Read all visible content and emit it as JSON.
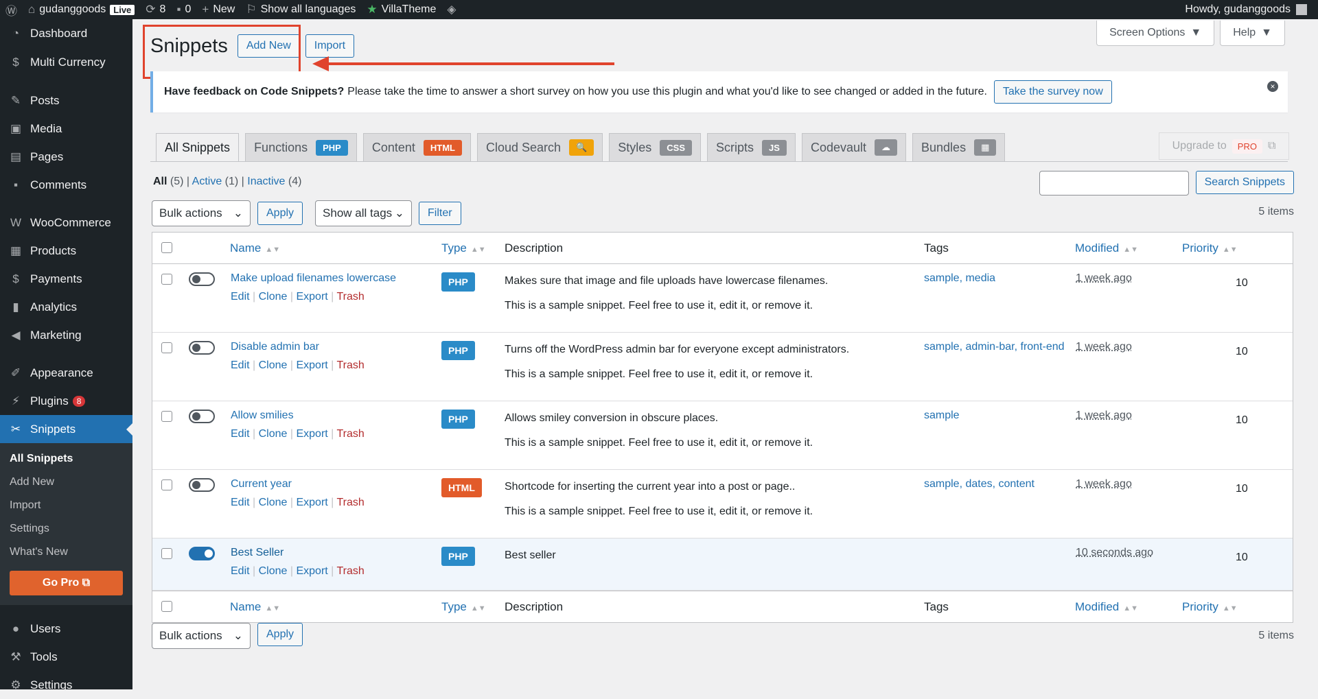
{
  "admin_bar": {
    "site_name": "gudanggoods",
    "live_label": "Live",
    "updates_count": "8",
    "comments_count": "0",
    "new_label": "New",
    "languages_label": "Show all languages",
    "villatheme_label": "VillaTheme",
    "howdy": "Howdy, gudanggoods"
  },
  "sidebar": {
    "items": [
      {
        "label": "Dashboard",
        "icon": "dashboard-icon"
      },
      {
        "label": "Multi Currency",
        "icon": "currency-icon"
      },
      {
        "label": "Posts",
        "icon": "pin-icon"
      },
      {
        "label": "Media",
        "icon": "media-icon"
      },
      {
        "label": "Pages",
        "icon": "page-icon"
      },
      {
        "label": "Comments",
        "icon": "comment-icon"
      },
      {
        "label": "WooCommerce",
        "icon": "woocommerce-icon"
      },
      {
        "label": "Products",
        "icon": "archive-icon"
      },
      {
        "label": "Payments",
        "icon": "payments-icon"
      },
      {
        "label": "Analytics",
        "icon": "bar-chart-icon"
      },
      {
        "label": "Marketing",
        "icon": "megaphone-icon"
      },
      {
        "label": "Appearance",
        "icon": "brush-icon"
      },
      {
        "label": "Plugins",
        "icon": "plug-icon",
        "badge": "8"
      },
      {
        "label": "Snippets",
        "icon": "scissors-icon"
      },
      {
        "label": "Users",
        "icon": "user-icon"
      },
      {
        "label": "Tools",
        "icon": "wrench-icon"
      },
      {
        "label": "Settings",
        "icon": "settings-icon"
      }
    ],
    "submenu": [
      "All Snippets",
      "Add New",
      "Import",
      "Settings",
      "What's New"
    ],
    "gopro_label": "Go Pro"
  },
  "header": {
    "title": "Snippets",
    "add_new_label": "Add New",
    "import_label": "Import",
    "screen_options_label": "Screen Options",
    "help_label": "Help"
  },
  "notice": {
    "strong": "Have feedback on Code Snippets?",
    "text": "Please take the time to answer a short survey on how you use this plugin and what you'd like to see changed or added in the future.",
    "button_label": "Take the survey now"
  },
  "tabs": [
    {
      "label": "All Snippets"
    },
    {
      "label": "Functions",
      "pill": "PHP"
    },
    {
      "label": "Content",
      "pill": "HTML"
    },
    {
      "label": "Cloud Search",
      "pill": "🔍"
    },
    {
      "label": "Styles",
      "pill": "CSS"
    },
    {
      "label": "Scripts",
      "pill": "JS"
    },
    {
      "label": "Codevault",
      "pill": "☁"
    },
    {
      "label": "Bundles",
      "pill": "▦"
    }
  ],
  "upgrade": {
    "label": "Upgrade to",
    "pro": "PRO"
  },
  "views": {
    "all": "All",
    "all_count": "(5)",
    "active": "Active",
    "active_count": "(1)",
    "inactive": "Inactive",
    "inactive_count": "(4)"
  },
  "search": {
    "button_label": "Search Snippets"
  },
  "tablenav": {
    "bulk_actions": "Bulk actions",
    "apply_label": "Apply",
    "tags_select": "Show all tags",
    "filter_label": "Filter",
    "items_count": "5 items"
  },
  "table": {
    "columns": {
      "name": "Name",
      "type": "Type",
      "description": "Description",
      "tags": "Tags",
      "modified": "Modified",
      "priority": "Priority"
    },
    "row_actions": {
      "edit": "Edit",
      "clone": "Clone",
      "export": "Export",
      "trash": "Trash"
    },
    "rows": [
      {
        "name": "Make upload filenames lowercase",
        "type": "PHP",
        "desc1": "Makes sure that image and file uploads have lowercase filenames.",
        "desc2": "This is a sample snippet. Feel free to use it, edit it, or remove it.",
        "tags": "sample, media",
        "modified": "1 week ago",
        "priority": "10",
        "active": false
      },
      {
        "name": "Disable admin bar",
        "type": "PHP",
        "desc1": "Turns off the WordPress admin bar for everyone except administrators.",
        "desc2": "This is a sample snippet. Feel free to use it, edit it, or remove it.",
        "tags": "sample, admin-bar, front-end",
        "modified": "1 week ago",
        "priority": "10",
        "active": false
      },
      {
        "name": "Allow smilies",
        "type": "PHP",
        "desc1": "Allows smiley conversion in obscure places.",
        "desc2": "This is a sample snippet. Feel free to use it, edit it, or remove it.",
        "tags": "sample",
        "modified": "1 week ago",
        "priority": "10",
        "active": false
      },
      {
        "name": "Current year",
        "type": "HTML",
        "desc1": "Shortcode for inserting the current year into a post or page..",
        "desc2": "This is a sample snippet. Feel free to use it, edit it, or remove it.",
        "tags": "sample, dates, content",
        "modified": "1 week ago",
        "priority": "10",
        "active": false
      },
      {
        "name": "Best Seller",
        "type": "PHP",
        "desc1": "Best seller",
        "desc2": "",
        "tags": "",
        "modified": "10 seconds ago",
        "priority": "10",
        "active": true
      }
    ]
  },
  "colors": {
    "accent": "#2271b1",
    "php_badge": "#2a8bc8",
    "html_badge": "#e25b2a",
    "highlight": "#e0432d",
    "admin_bg": "#1d2327"
  }
}
